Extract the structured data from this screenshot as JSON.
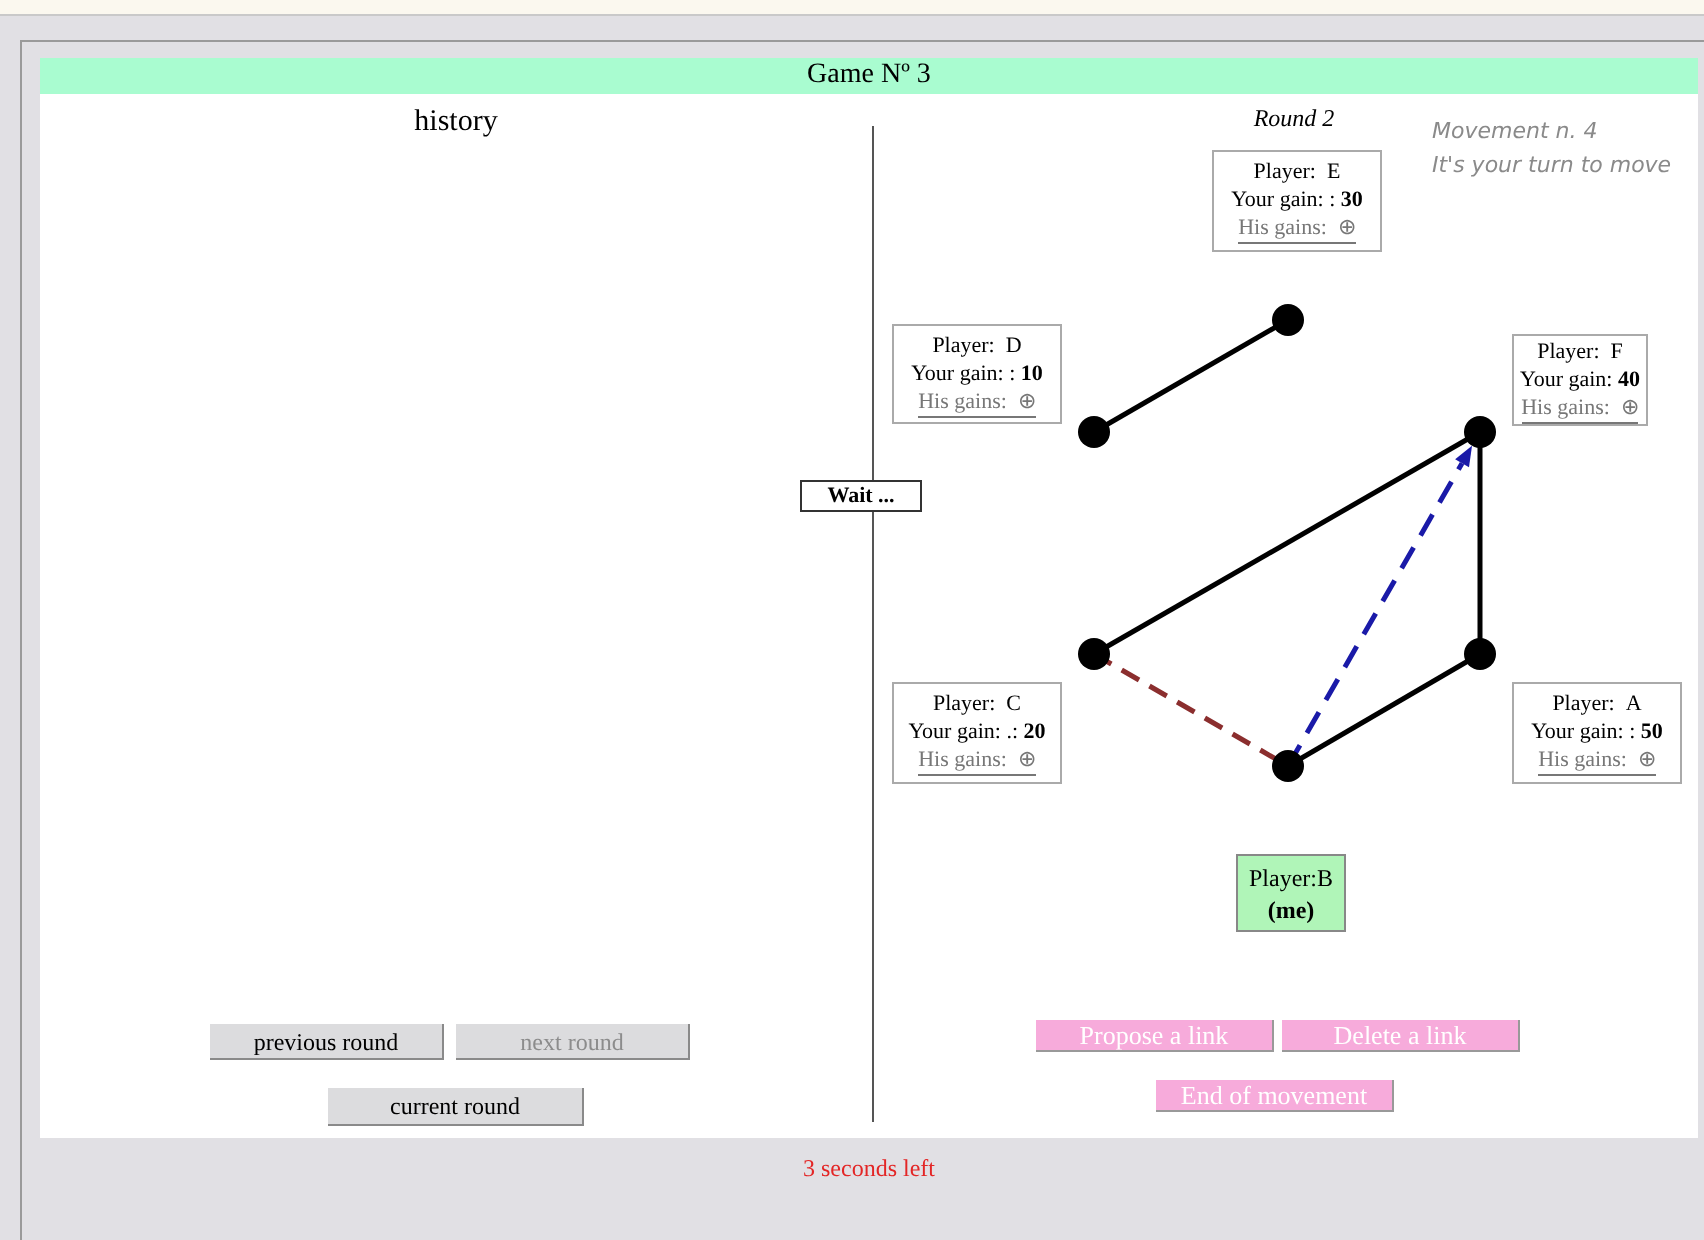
{
  "title": "Game Nº 3",
  "history": {
    "title": "history",
    "buttons": [
      {
        "label": "previous round",
        "disabled": false
      },
      {
        "label": "next round",
        "disabled": true
      }
    ],
    "current_button": {
      "label": "current round",
      "disabled": false
    }
  },
  "wait_button": "Wait ...",
  "round": "Round 2",
  "movement": "Movement n. 4",
  "turn_message": "It's your turn to move",
  "players": [
    {
      "player_label": "Player:",
      "name": "E",
      "gain_label": "Your gain: :",
      "gain": "30",
      "his_gains": "His gains:",
      "his_icon": "⊕",
      "me": false
    },
    {
      "player_label": "Player:",
      "name": "D",
      "gain_label": "Your gain: :",
      "gain": "10",
      "his_gains": "His gains:",
      "his_icon": "⊕",
      "me": false
    },
    {
      "player_label": "Player:",
      "name": "F",
      "gain_label": "Your gain:",
      "gain": "40",
      "his_gains": "His gains:",
      "his_icon": "⊕",
      "me": false
    },
    {
      "player_label": "Player:",
      "name": "C",
      "gain_label": "Your gain: .:",
      "gain": "20",
      "his_gains": "His gains:",
      "his_icon": "⊕",
      "me": false
    },
    {
      "player_label": "Player:",
      "name": "A",
      "gain_label": "Your gain: :",
      "gain": "50",
      "his_gains": "His gains:",
      "his_icon": "⊕",
      "me": false
    },
    {
      "player_label": "Player:",
      "name": "B",
      "me_label": "(me)",
      "me": true
    }
  ],
  "links": [
    {
      "kind": "link"
    },
    {
      "kind": "link"
    },
    {
      "kind": "link"
    },
    {
      "kind": "link"
    },
    {
      "kind": "pending",
      "color": "#8b2e2e"
    },
    {
      "kind": "proposal",
      "color": "#1a1aa8"
    }
  ],
  "actions": [
    {
      "label": "Propose a link"
    },
    {
      "label": "Delete a link"
    },
    {
      "label": "End of movement"
    }
  ],
  "timer": "3 seconds left"
}
